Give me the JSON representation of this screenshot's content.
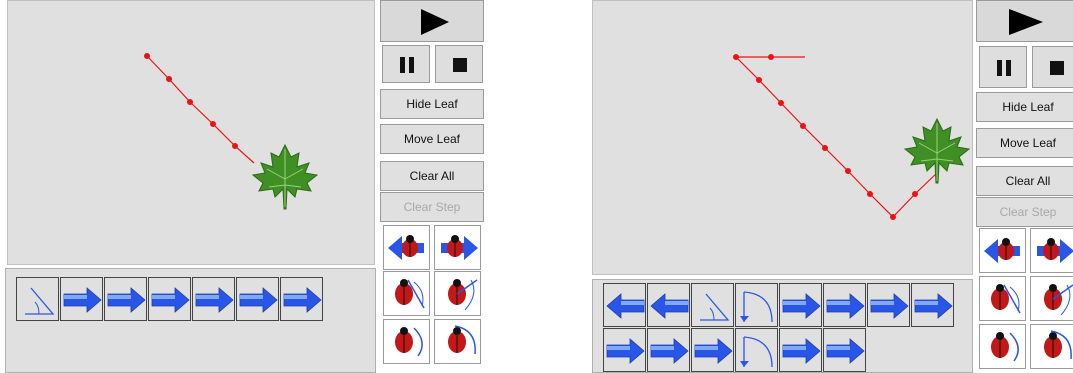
{
  "colors": {
    "path": "#ee1111",
    "canvas": "#e0e0e0",
    "arrow": "#2a56e8",
    "panel": "#d9d9d9"
  },
  "panels": [
    {
      "controls": {
        "play_icon": "play-icon",
        "pause_icon": "pause-icon",
        "stop_icon": "stop-icon",
        "hide_leaf": "Hide Leaf",
        "move_leaf": "Move Leaf",
        "clear_all": "Clear All",
        "clear_step": "Clear Step"
      },
      "program_steps": [
        "turn-angle",
        "forward",
        "forward",
        "forward",
        "forward",
        "forward",
        "forward"
      ]
    },
    {
      "controls": {
        "play_icon": "play-icon",
        "pause_icon": "pause-icon",
        "stop_icon": "stop-icon",
        "hide_leaf": "Hide Leaf",
        "move_leaf": "Move Leaf",
        "clear_all": "Clear All",
        "clear_step": "Clear Step"
      },
      "program_steps": [
        "backward",
        "backward",
        "turn-angle",
        "turn-arc",
        "forward",
        "forward",
        "forward",
        "forward",
        "forward",
        "forward",
        "forward",
        "turn-arc",
        "forward",
        "forward"
      ]
    }
  ]
}
